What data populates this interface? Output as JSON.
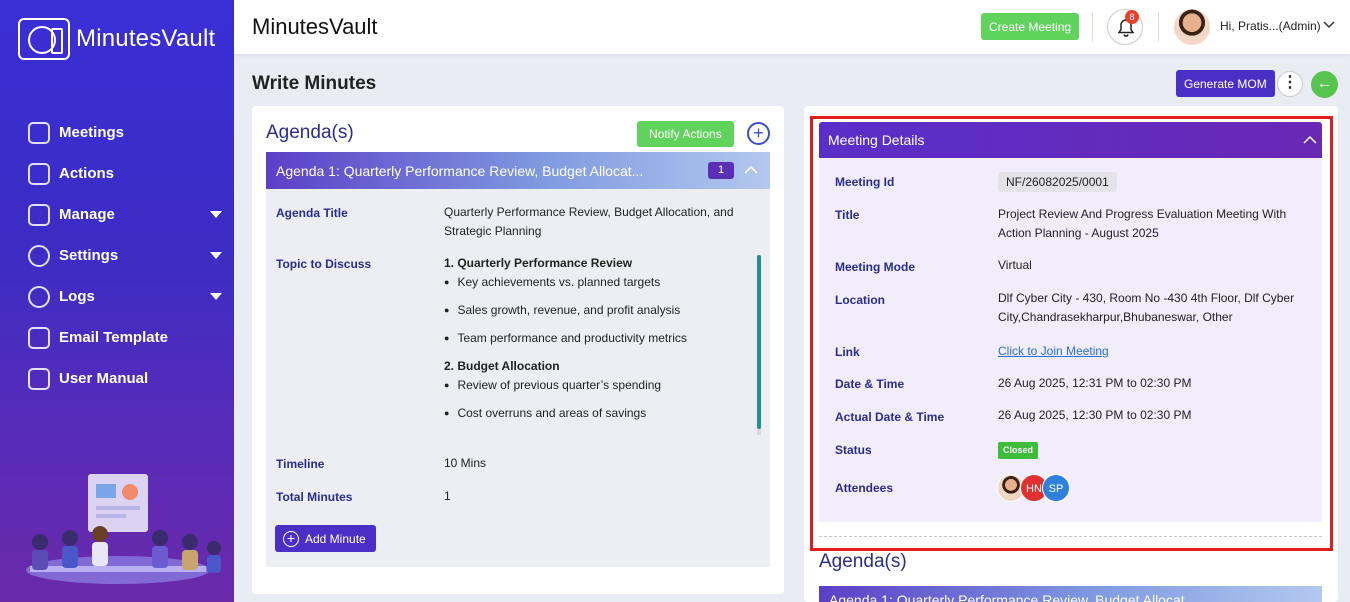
{
  "brand": {
    "name": "MinutesVault"
  },
  "sidebar": {
    "items": [
      {
        "label": "Meetings",
        "icon": "meetings-icon"
      },
      {
        "label": "Actions",
        "icon": "actions-icon"
      },
      {
        "label": "Manage",
        "icon": "manage-icon",
        "has_submenu": true
      },
      {
        "label": "Settings",
        "icon": "gear-icon",
        "has_submenu": true
      },
      {
        "label": "Logs",
        "icon": "history-icon",
        "has_submenu": true
      },
      {
        "label": "Email Template",
        "icon": "email-icon"
      },
      {
        "label": "User Manual",
        "icon": "book-icon"
      }
    ]
  },
  "topbar": {
    "title": "MinutesVault",
    "create_meeting": "Create Meeting",
    "notification_count": "8",
    "user_greeting": "Hi, Pratis...(Admin)"
  },
  "page": {
    "title": "Write Minutes",
    "generate_mom": "Generate MOM",
    "more": "⋮",
    "back": "←"
  },
  "left": {
    "heading": "Agenda(s)",
    "notify_actions": "Notify Actions",
    "add": "+",
    "agenda_title_bar": "Agenda 1: Quarterly Performance Review, Budget Allocat...",
    "agenda_count": "1",
    "labels": {
      "agenda_title": "Agenda Title",
      "topic": "Topic to Discuss",
      "timeline": "Timeline",
      "total_minutes": "Total Minutes"
    },
    "agenda_title_value": "Quarterly Performance Review, Budget Allocation, and Strategic Planning",
    "topics": [
      {
        "heading": "1. Quarterly Performance Review",
        "bullets": [
          "Key achievements vs. planned targets",
          "Sales growth, revenue, and profit analysis",
          "Team performance and productivity metrics"
        ]
      },
      {
        "heading": "2. Budget Allocation",
        "bullets": [
          "Review of previous quarter’s spending",
          "Cost overruns and areas of savings"
        ]
      }
    ],
    "timeline_value": "10 Mins",
    "total_minutes_value": "1",
    "add_minute": "Add Minute"
  },
  "meeting_details": {
    "header": "Meeting Details",
    "labels": {
      "meeting_id": "Meeting Id",
      "title": "Title",
      "mode": "Meeting Mode",
      "location": "Location",
      "link": "Link",
      "date_time": "Date & Time",
      "actual_date_time": "Actual Date & Time",
      "status": "Status",
      "attendees": "Attendees"
    },
    "meeting_id": "NF/26082025/0001",
    "title": "Project Review And Progress Evaluation Meeting With Action Planning - August 2025",
    "mode": "Virtual",
    "location": "Dlf Cyber City - 430, Room No -430 4th Floor, Dlf Cyber City,Chandrasekharpur,Bhubaneswar, Other",
    "link_text": "Click to Join Meeting",
    "date_time": "26 Aug 2025, 12:31 PM to 02:30 PM",
    "actual_date_time": "26 Aug 2025, 12:30 PM to 02:30 PM",
    "status": "Closed",
    "attendees": [
      {
        "initials": "",
        "color": "#f1d6c4"
      },
      {
        "initials": "HN",
        "color": "#e03131"
      },
      {
        "initials": "SP",
        "color": "#2f80d8"
      }
    ]
  },
  "right_agenda": {
    "heading": "Agenda(s)",
    "bar": "Agenda 1: Quarterly Performance Review, Budget Allocat..."
  }
}
